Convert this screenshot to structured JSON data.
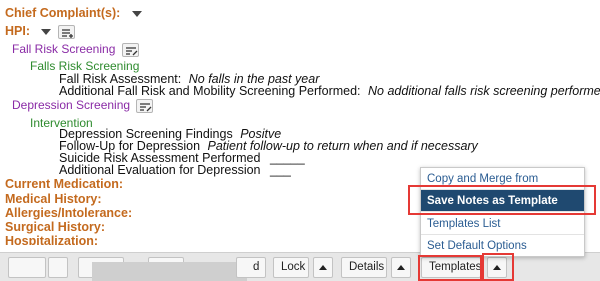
{
  "note": {
    "chief_complaint": "Chief Complaint(s):",
    "hpi": "HPI:",
    "fall_risk_screening": "Fall Risk Screening",
    "falls_risk_screening": "Falls Risk Screening",
    "fall_risk_assessment_label": "Fall Risk Assessment:",
    "fall_risk_assessment_value": "No falls in the past year",
    "additional_fall_label": "Additional Fall Risk and Mobility Screening Performed:",
    "additional_fall_value": "No additional falls risk screening performed",
    "depression_screening": "Depression Screening",
    "intervention": "Intervention",
    "depression_findings_label": "Depression Screening Findings",
    "depression_findings_value": "Positve",
    "followup_label": "Follow-Up for Depression",
    "followup_value": "Patient follow-up to return when and if necessary",
    "suicide_label": "Suicide Risk Assessment Performed",
    "suicide_blank": "_____",
    "additional_eval_label": "Additional Evaluation for Depression",
    "additional_eval_blank": "___",
    "current_medication": "Current Medication:",
    "medical_history": "Medical History:",
    "allergies": "Allergies/Intolerance:",
    "surgical_history": "Surgical History:",
    "hospitalization": "Hospitalization:"
  },
  "toolbar": {
    "partial_label": "d",
    "lock": "Lock",
    "details": "Details",
    "templates": "Templates"
  },
  "templates_menu": {
    "items": [
      "Copy and Merge from Templates",
      "Save Notes as Template",
      "Templates List",
      "Set Default Options"
    ],
    "highlighted_index": 1
  },
  "colors": {
    "section_heading": "#c46a1e",
    "subsection": "#8a2ba6",
    "subsubsection": "#2e8b2e",
    "menu_link": "#2a5c92",
    "menu_highlight": "#1f4970",
    "annotation_box": "#e53935"
  }
}
